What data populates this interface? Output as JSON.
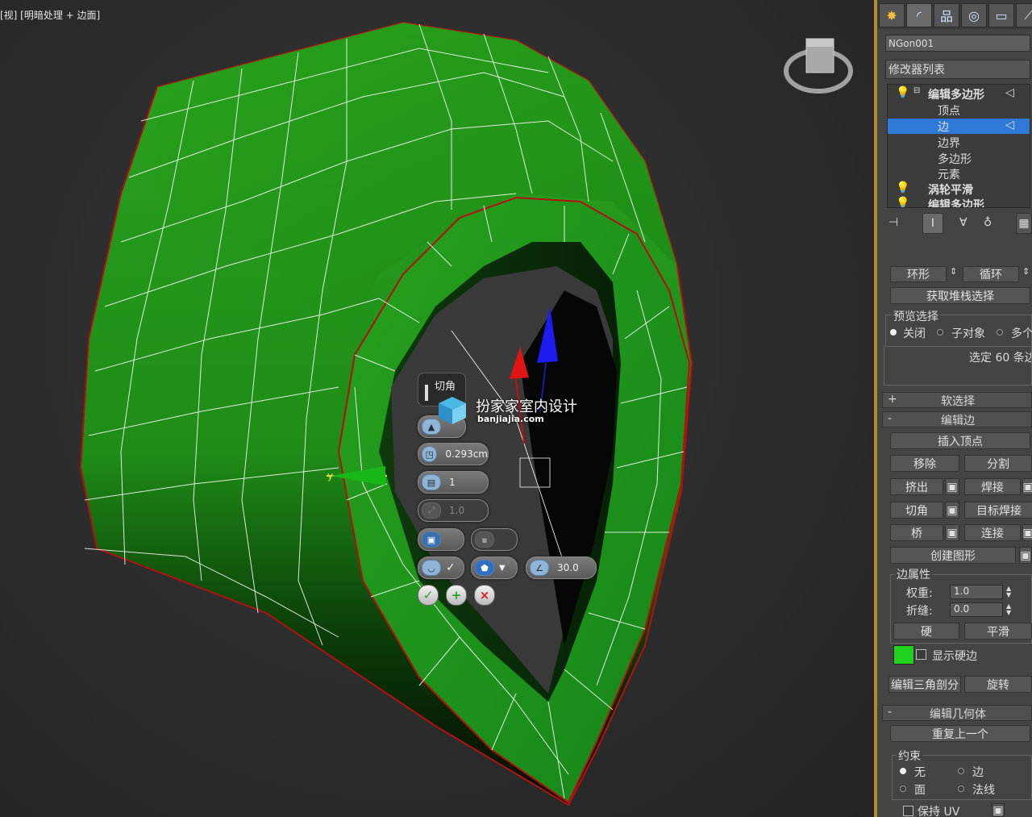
{
  "viewport": {
    "label": "[视] [明暗处理 + 边面]",
    "caddy": {
      "title": "切角",
      "amount": "0.293cm",
      "segments": "1",
      "tension": "1.0",
      "angle": "30.0",
      "buttons": [
        "check-icon",
        "plus-icon",
        "cancel-icon"
      ]
    },
    "gizmo_axis": "y",
    "watermark": {
      "cn": "扮家家室内设计",
      "en": "banjiajia.com"
    },
    "colors": {
      "mesh": "#1e9a16",
      "wire": "#ffffff",
      "selected_edge": "#e01010"
    }
  },
  "panel": {
    "tabs": [
      "create-icon",
      "modify-icon",
      "hierarchy-icon",
      "motion-icon",
      "display-icon",
      "utilities-icon"
    ],
    "object_name": "NGon001",
    "modifier_list": "修改器列表",
    "stack": {
      "items": [
        {
          "label": "编辑多边形",
          "bold": true
        },
        {
          "label": "顶点"
        },
        {
          "label": "边",
          "selected": true
        },
        {
          "label": "边界"
        },
        {
          "label": "多边形"
        },
        {
          "label": "元素"
        },
        {
          "label": "涡轮平滑",
          "bold": true
        },
        {
          "label": "编辑多边形",
          "bold": true
        }
      ]
    },
    "selection": {
      "ring": "环形",
      "loop": "循环",
      "get_stack": "获取堆栈选择",
      "preview_title": "预览选择",
      "preview_options": [
        "关闭",
        "子对象",
        "多个"
      ],
      "status": "选定 60 条边"
    },
    "soft_selection": "软选择",
    "edit_edges": {
      "title": "编辑边",
      "insert_vertex": "插入顶点",
      "remove": "移除",
      "split": "分割",
      "extrude": "挤出",
      "weld": "焊接",
      "chamfer": "切角",
      "target_weld": "目标焊接",
      "bridge": "桥",
      "connect": "连接",
      "create_shape": "创建图形",
      "edge_props": "边属性",
      "weight_label": "权重:",
      "weight": "1.0",
      "crease_label": "折缝:",
      "crease": "0.0",
      "hard": "硬",
      "smooth": "平滑",
      "show_hard": "显示硬边",
      "hard_color": "#1ed21e",
      "edit_tri": "编辑三角剖分",
      "turn": "旋转"
    },
    "edit_geometry": {
      "title": "编辑几何体",
      "repeat_last": "重复上一个",
      "constraints": "约束",
      "c_none": "无",
      "c_edge": "边",
      "c_face": "面",
      "c_normal": "法线",
      "preserve_uv": "保持 UV"
    }
  }
}
